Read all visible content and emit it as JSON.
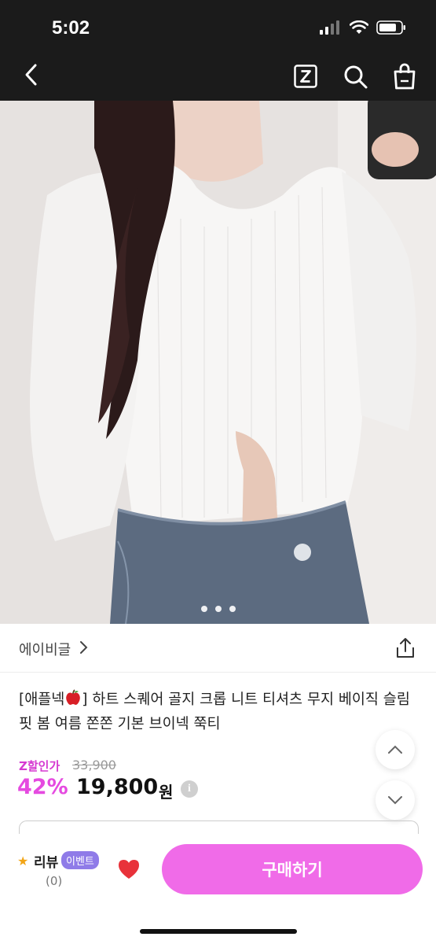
{
  "status_bar": {
    "time": "5:02"
  },
  "nav": {
    "back_icon": "chevron-left-icon",
    "z_icon": "z-logo-icon",
    "search_icon": "search-icon",
    "bag_icon": "shopping-bag-icon"
  },
  "product": {
    "image_pages": 3,
    "seller": "에이비글",
    "title_prefix": "[애플넥",
    "title_suffix": "] 하트 스퀘어 골지 크롭 니트 티셔츠 무지 베이직 슬림핏 봄 여름 쫀쫀 기본 브이넥 쭉티",
    "z_price_label": "Z할인가",
    "original_price": "33,900",
    "discount": "42%",
    "price": "19,800",
    "currency": "원",
    "info_symbol": "i"
  },
  "bottom_bar": {
    "review_label": "리뷰",
    "event_badge": "이벤트",
    "review_count": "(0)",
    "buy_label": "구매하기"
  },
  "colors": {
    "accent": "#f06be8",
    "discount": "#e54ae0",
    "badge": "#8f7be8",
    "heart": "#e8323a"
  }
}
